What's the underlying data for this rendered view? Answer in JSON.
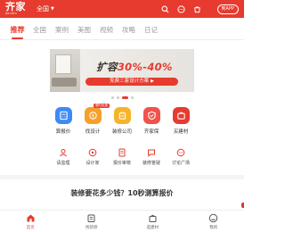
{
  "header": {
    "logo": "齐家",
    "logo_sub": "Jia.com",
    "city": "全国",
    "app_button": "到APP",
    "bg_color": "#e63b2e"
  },
  "tabs": [
    {
      "label": "推荐",
      "active": true
    },
    {
      "label": "全国",
      "active": false
    },
    {
      "label": "案例",
      "active": false
    },
    {
      "label": "美图",
      "active": false
    },
    {
      "label": "视频",
      "active": false
    },
    {
      "label": "攻略",
      "active": false
    },
    {
      "label": "日记",
      "active": false
    }
  ],
  "banner": {
    "title_prefix": "扩容",
    "title_highlight": "30%-40%",
    "pill_text": "免费三套设计方案"
  },
  "services": [
    {
      "label": "算报价",
      "color": "#3d8af7",
      "icon": "calculator-icon"
    },
    {
      "label": "找设计",
      "color": "#f5a02a",
      "icon": "design-icon",
      "badge": "限时优惠"
    },
    {
      "label": "装修公司",
      "color": "#f5b42a",
      "icon": "company-icon"
    },
    {
      "label": "齐家保",
      "color": "#f0524c",
      "icon": "shield-icon"
    },
    {
      "label": "买建材",
      "color": "#e63b2e",
      "icon": "shopping-icon"
    }
  ],
  "tools": [
    {
      "label": "请监理",
      "icon": "supervisor-icon"
    },
    {
      "label": "设计家",
      "icon": "designer-icon"
    },
    {
      "label": "报价审核",
      "icon": "quote-review-icon"
    },
    {
      "label": "装修答疑",
      "icon": "faq-icon"
    },
    {
      "label": "讨论广场",
      "icon": "forum-icon"
    }
  ],
  "promo_text": "装修要花多少钱？10秒测算报价",
  "bottom_nav": [
    {
      "label": "首页",
      "icon": "home-icon",
      "active": true
    },
    {
      "label": "找装修",
      "icon": "renovation-icon",
      "active": false
    },
    {
      "label": "选建材",
      "icon": "materials-icon",
      "active": false
    },
    {
      "label": "我的",
      "icon": "profile-icon",
      "active": false
    }
  ]
}
